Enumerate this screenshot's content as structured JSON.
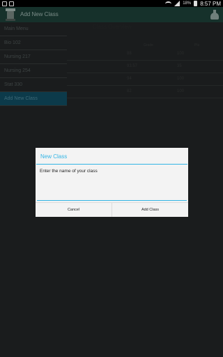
{
  "status_bar": {
    "battery": "18%",
    "time": "8:57 PM"
  },
  "action_bar": {
    "title": "Add New Class",
    "app_icon": "mortarboard-stack-icon",
    "action_icon": "flask-icon"
  },
  "overview": {
    "title": "Class Overview",
    "headers": {
      "grade": "Grade",
      "points": "Pts"
    },
    "rows": [
      {
        "grade": "88",
        "points": "100"
      },
      {
        "grade": "93.57",
        "points": "35"
      },
      {
        "grade": "94",
        "points": "100"
      },
      {
        "grade": "82",
        "points": "100"
      }
    ]
  },
  "drawer": {
    "items": [
      {
        "label": "Main Menu"
      },
      {
        "label": "Bio 102"
      },
      {
        "label": "Nursing 217"
      },
      {
        "label": "Nursing 254"
      },
      {
        "label": "Stat 330"
      },
      {
        "label": "Add New Class"
      }
    ]
  },
  "dialog": {
    "title": "New Class",
    "input_placeholder": "Enter the name of your class",
    "input_value": "",
    "cancel_label": "Cancel",
    "confirm_label": "Add Class"
  },
  "colors": {
    "accent": "#33b5e5",
    "actionbar": "#16312b",
    "drawer_active": "#0c3a4a"
  }
}
